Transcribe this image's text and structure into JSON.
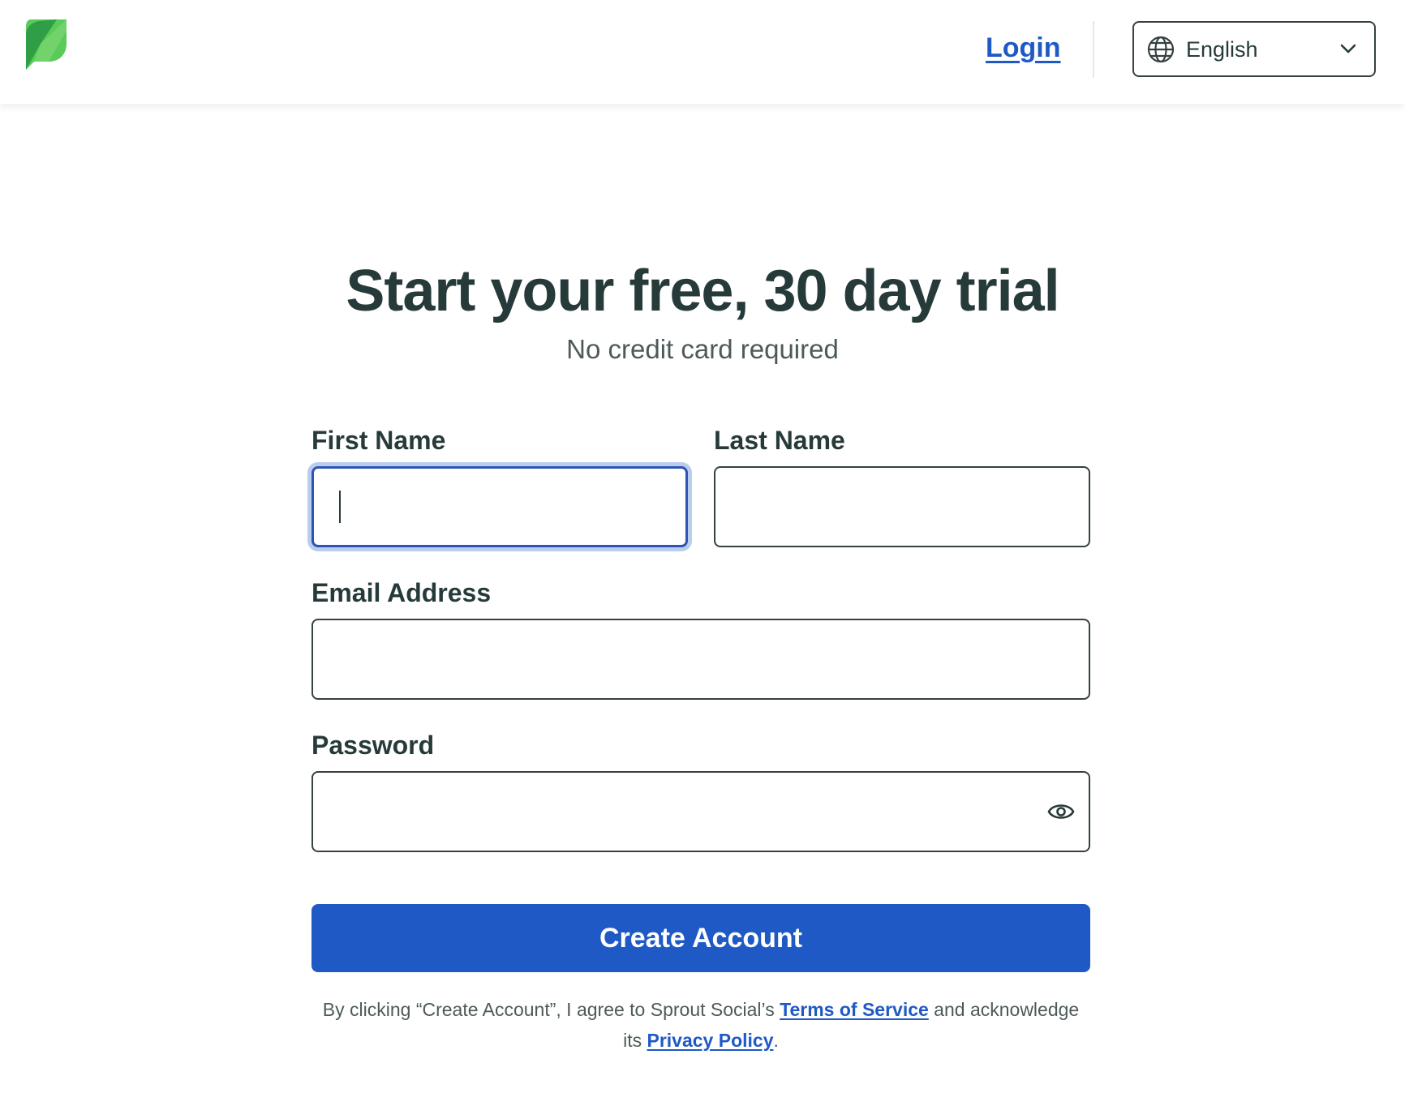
{
  "header": {
    "logo_name": "sprout-leaf-logo",
    "login_label": "Login",
    "language": {
      "selected": "English",
      "icon": "globe-icon"
    }
  },
  "hero": {
    "title": "Start your free, 30 day trial",
    "subtitle": "No credit card required"
  },
  "form": {
    "first_name": {
      "label": "First Name",
      "value": "",
      "focused": true
    },
    "last_name": {
      "label": "Last Name",
      "value": ""
    },
    "email": {
      "label": "Email Address",
      "value": ""
    },
    "password": {
      "label": "Password",
      "value": "",
      "toggle_icon": "eye-icon"
    },
    "submit_label": "Create Account"
  },
  "legal": {
    "prefix": "By clicking “Create Account”, I agree to Sprout Social’s ",
    "terms_label": "Terms of Service",
    "middle": " and acknowledge its ",
    "privacy_label": "Privacy Policy",
    "suffix": "."
  },
  "colors": {
    "brand_blue": "#1f59c5",
    "text_dark": "#273a3a",
    "brand_green_light": "#59cb59",
    "brand_green_dark": "#2f9e46",
    "focus_ring": "#b9cdee"
  }
}
